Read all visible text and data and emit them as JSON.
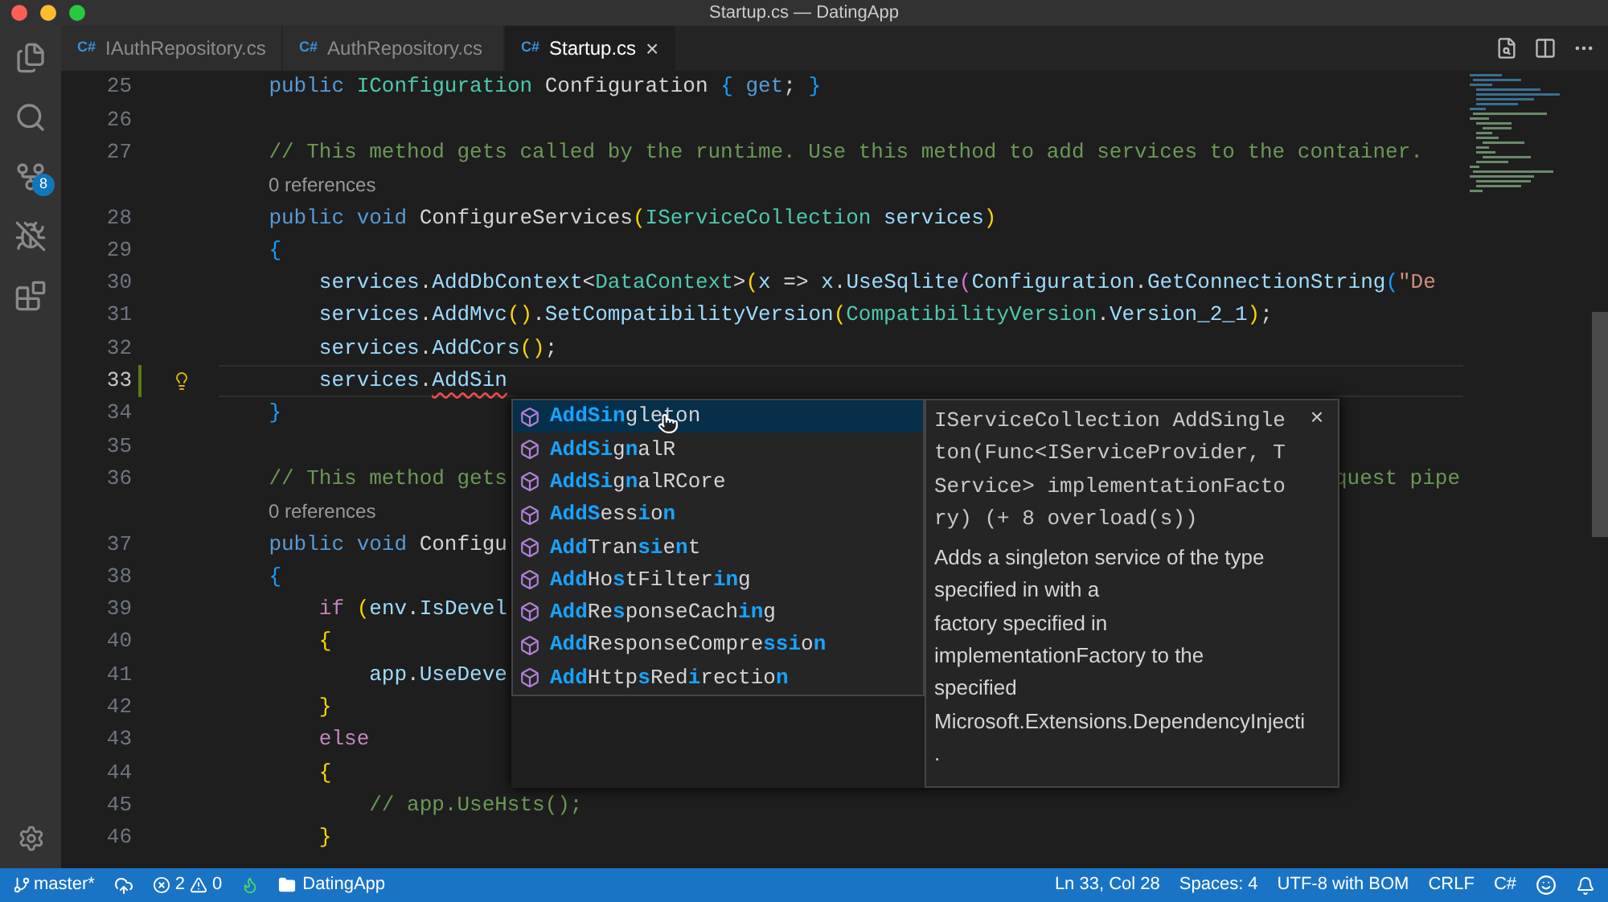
{
  "window": {
    "title": "Startup.cs — DatingApp"
  },
  "activity_bar": {
    "source_control_badge": "8"
  },
  "tabs": [
    {
      "lang": "C#",
      "label": "IAuthRepository.cs",
      "selected": false
    },
    {
      "lang": "C#",
      "label": "AuthRepository.cs",
      "selected": false
    },
    {
      "lang": "C#",
      "label": "Startup.cs",
      "selected": true,
      "close": "×"
    }
  ],
  "editor": {
    "lines": [
      {
        "kind": "code",
        "number": "25",
        "current": false,
        "modified": false,
        "lightbulb": false,
        "tokens": [
          {
            "text": "    public ",
            "kind": "kw"
          },
          {
            "text": "IConfiguration",
            "kind": "type"
          },
          {
            "text": " Configuration ",
            "kind": "p"
          },
          {
            "text": "{ ",
            "kind": "b1"
          },
          {
            "text": "get",
            "kind": "kw"
          },
          {
            "text": "; ",
            "kind": "p"
          },
          {
            "text": "}",
            "kind": "b1"
          }
        ]
      },
      {
        "kind": "code",
        "number": "26",
        "current": false,
        "modified": false,
        "lightbulb": false
      },
      {
        "kind": "code",
        "number": "27",
        "current": false,
        "modified": false,
        "lightbulb": false,
        "tokens": [
          {
            "text": "    // This method gets called by the runtime. Use this method to add services to the container.",
            "kind": "c"
          }
        ]
      },
      {
        "kind": "lens",
        "text": "0 references"
      },
      {
        "kind": "code",
        "number": "28",
        "current": false,
        "modified": false,
        "lightbulb": false,
        "tokens": [
          {
            "text": "    public void ",
            "kind": "kw"
          },
          {
            "text": "ConfigureServices",
            "kind": "p"
          },
          {
            "text": "(",
            "kind": "b2"
          },
          {
            "text": "IServiceCollection",
            "kind": "type"
          },
          {
            "text": " services",
            "kind": "v"
          },
          {
            "text": ")",
            "kind": "b2"
          }
        ]
      },
      {
        "kind": "code",
        "number": "29",
        "current": false,
        "modified": false,
        "lightbulb": false,
        "tokens": [
          {
            "text": "    {",
            "kind": "b1"
          }
        ]
      },
      {
        "kind": "code",
        "number": "30",
        "current": false,
        "modified": false,
        "lightbulb": false,
        "tokens": [
          {
            "text": "        services",
            "kind": "v"
          },
          {
            "text": ".",
            "kind": "p"
          },
          {
            "text": "AddDbContext",
            "kind": "v"
          },
          {
            "text": "<",
            "kind": "p"
          },
          {
            "text": "DataContext",
            "kind": "type"
          },
          {
            "text": ">",
            "kind": "p"
          },
          {
            "text": "(",
            "kind": "b2"
          },
          {
            "text": "x",
            "kind": "v"
          },
          {
            "text": " => ",
            "kind": "p"
          },
          {
            "text": "x",
            "kind": "v"
          },
          {
            "text": ".",
            "kind": "p"
          },
          {
            "text": "UseSqlite",
            "kind": "v"
          },
          {
            "text": "(",
            "kind": "b3"
          },
          {
            "text": "Configuration",
            "kind": "v"
          },
          {
            "text": ".",
            "kind": "p"
          },
          {
            "text": "GetConnectionString",
            "kind": "v"
          },
          {
            "text": "(",
            "kind": "b1"
          },
          {
            "text": "\"De",
            "kind": "s"
          }
        ]
      },
      {
        "kind": "code",
        "number": "31",
        "current": false,
        "modified": false,
        "lightbulb": false,
        "tokens": [
          {
            "text": "        services",
            "kind": "v"
          },
          {
            "text": ".",
            "kind": "p"
          },
          {
            "text": "AddMvc",
            "kind": "v"
          },
          {
            "text": "()",
            "kind": "b2"
          },
          {
            "text": ".",
            "kind": "p"
          },
          {
            "text": "SetCompatibilityVersion",
            "kind": "v"
          },
          {
            "text": "(",
            "kind": "b2"
          },
          {
            "text": "CompatibilityVersion",
            "kind": "type"
          },
          {
            "text": ".",
            "kind": "p"
          },
          {
            "text": "Version_2_1",
            "kind": "v"
          },
          {
            "text": ")",
            "kind": "b2"
          },
          {
            "text": ";",
            "kind": "p"
          }
        ]
      },
      {
        "kind": "code",
        "number": "32",
        "current": false,
        "modified": false,
        "lightbulb": false,
        "tokens": [
          {
            "text": "        services",
            "kind": "v"
          },
          {
            "text": ".",
            "kind": "p"
          },
          {
            "text": "AddCors",
            "kind": "v"
          },
          {
            "text": "()",
            "kind": "b2"
          },
          {
            "text": ";",
            "kind": "p"
          }
        ]
      },
      {
        "kind": "code",
        "number": "33",
        "current": true,
        "modified": true,
        "lightbulb": true,
        "tokens": [
          {
            "text": "        services",
            "kind": "v"
          },
          {
            "text": ".",
            "kind": "p"
          },
          {
            "text": "AddSin",
            "kind": "err"
          }
        ]
      },
      {
        "kind": "code",
        "number": "34",
        "current": false,
        "modified": false,
        "lightbulb": false,
        "tokens": [
          {
            "text": "    }",
            "kind": "b1"
          }
        ]
      },
      {
        "kind": "code",
        "number": "35",
        "current": false,
        "modified": false,
        "lightbulb": false
      },
      {
        "kind": "code",
        "number": "36",
        "current": false,
        "modified": false,
        "lightbulb": false,
        "tokens": [
          {
            "text": "    // This method gets",
            "kind": "c"
          }
        ],
        "tail": "quest pipe"
      },
      {
        "kind": "lens",
        "text": "0 references"
      },
      {
        "kind": "code",
        "number": "37",
        "current": false,
        "modified": false,
        "lightbulb": false,
        "tokens": [
          {
            "text": "    public void ",
            "kind": "kw"
          },
          {
            "text": "Configu",
            "kind": "p"
          }
        ]
      },
      {
        "kind": "code",
        "number": "38",
        "current": false,
        "modified": false,
        "lightbulb": false,
        "tokens": [
          {
            "text": "    {",
            "kind": "b1"
          }
        ]
      },
      {
        "kind": "code",
        "number": "39",
        "current": false,
        "modified": false,
        "lightbulb": false,
        "tokens": [
          {
            "text": "        if ",
            "kind": "ctl"
          },
          {
            "text": "(",
            "kind": "b2"
          },
          {
            "text": "env",
            "kind": "v"
          },
          {
            "text": ".",
            "kind": "p"
          },
          {
            "text": "IsDevel",
            "kind": "v"
          }
        ]
      },
      {
        "kind": "code",
        "number": "40",
        "current": false,
        "modified": false,
        "lightbulb": false,
        "tokens": [
          {
            "text": "        {",
            "kind": "b2"
          }
        ]
      },
      {
        "kind": "code",
        "number": "41",
        "current": false,
        "modified": false,
        "lightbulb": false,
        "tokens": [
          {
            "text": "            app",
            "kind": "v"
          },
          {
            "text": ".",
            "kind": "p"
          },
          {
            "text": "UseDeve",
            "kind": "v"
          }
        ]
      },
      {
        "kind": "code",
        "number": "42",
        "current": false,
        "modified": false,
        "lightbulb": false,
        "tokens": [
          {
            "text": "        }",
            "kind": "b2"
          }
        ]
      },
      {
        "kind": "code",
        "number": "43",
        "current": false,
        "modified": false,
        "lightbulb": false,
        "tokens": [
          {
            "text": "        else",
            "kind": "ctl"
          }
        ]
      },
      {
        "kind": "code",
        "number": "44",
        "current": false,
        "modified": false,
        "lightbulb": false,
        "tokens": [
          {
            "text": "        {",
            "kind": "b2"
          }
        ]
      },
      {
        "kind": "code",
        "number": "45",
        "current": false,
        "modified": false,
        "lightbulb": false,
        "tokens": [
          {
            "text": "            // app.UseHsts();",
            "kind": "c"
          }
        ]
      },
      {
        "kind": "code",
        "number": "46",
        "current": false,
        "modified": false,
        "lightbulb": false,
        "tokens": [
          {
            "text": "        }",
            "kind": "b2"
          }
        ]
      }
    ]
  },
  "suggestions": [
    {
      "selected": true,
      "parts": [
        {
          "text": "AddSin",
          "kind": "match"
        },
        {
          "text": "gleton",
          "kind": "plain"
        }
      ]
    },
    {
      "selected": false,
      "parts": [
        {
          "text": "AddSi",
          "kind": "match"
        },
        {
          "text": "g",
          "kind": "plain"
        },
        {
          "text": "n",
          "kind": "match"
        },
        {
          "text": "alR",
          "kind": "plain"
        }
      ]
    },
    {
      "selected": false,
      "parts": [
        {
          "text": "AddSi",
          "kind": "match"
        },
        {
          "text": "g",
          "kind": "plain"
        },
        {
          "text": "n",
          "kind": "match"
        },
        {
          "text": "alRCore",
          "kind": "plain"
        }
      ]
    },
    {
      "selected": false,
      "parts": [
        {
          "text": "AddS",
          "kind": "match"
        },
        {
          "text": "ess",
          "kind": "plain"
        },
        {
          "text": "i",
          "kind": "match"
        },
        {
          "text": "o",
          "kind": "plain"
        },
        {
          "text": "n",
          "kind": "match"
        }
      ]
    },
    {
      "selected": false,
      "parts": [
        {
          "text": "Add",
          "kind": "match"
        },
        {
          "text": "Tran",
          "kind": "plain"
        },
        {
          "text": "si",
          "kind": "match"
        },
        {
          "text": "e",
          "kind": "plain"
        },
        {
          "text": "n",
          "kind": "match"
        },
        {
          "text": "t",
          "kind": "plain"
        }
      ]
    },
    {
      "selected": false,
      "parts": [
        {
          "text": "Add",
          "kind": "match"
        },
        {
          "text": "Ho",
          "kind": "plain"
        },
        {
          "text": "s",
          "kind": "match"
        },
        {
          "text": "tFilter",
          "kind": "plain"
        },
        {
          "text": "in",
          "kind": "match"
        },
        {
          "text": "g",
          "kind": "plain"
        }
      ]
    },
    {
      "selected": false,
      "parts": [
        {
          "text": "Add",
          "kind": "match"
        },
        {
          "text": "Re",
          "kind": "plain"
        },
        {
          "text": "s",
          "kind": "match"
        },
        {
          "text": "ponseCach",
          "kind": "plain"
        },
        {
          "text": "in",
          "kind": "match"
        },
        {
          "text": "g",
          "kind": "plain"
        }
      ]
    },
    {
      "selected": false,
      "parts": [
        {
          "text": "Add",
          "kind": "match"
        },
        {
          "text": "ResponseCompre",
          "kind": "plain"
        },
        {
          "text": "ssi",
          "kind": "match"
        },
        {
          "text": "o",
          "kind": "plain"
        },
        {
          "text": "n",
          "kind": "match"
        }
      ]
    },
    {
      "selected": false,
      "parts": [
        {
          "text": "Add",
          "kind": "match"
        },
        {
          "text": "Http",
          "kind": "plain"
        },
        {
          "text": "s",
          "kind": "match"
        },
        {
          "text": "Red",
          "kind": "plain"
        },
        {
          "text": "i",
          "kind": "match"
        },
        {
          "text": "rectio",
          "kind": "plain"
        },
        {
          "text": "n",
          "kind": "match"
        }
      ]
    }
  ],
  "details": {
    "close": "×",
    "signature": [
      "IServiceCollection AddSingle",
      "ton(Func<IServiceProvider, T",
      "Service> implementationFacto",
      "ry) (+ 8 overload(s))"
    ],
    "docs": [
      "Adds a singleton service of the type",
      "specified in with a",
      "factory specified in",
      "implementationFactory to the",
      "specified",
      "Microsoft.Extensions.DependencyInjecti",
      "."
    ]
  },
  "status_bar": {
    "branch": "master*",
    "errors": "2",
    "warnings": "0",
    "folder": "DatingApp",
    "position": "Ln 33, Col 28",
    "spaces": "Spaces: 4",
    "encoding": "UTF-8 with BOM",
    "eol": "CRLF",
    "language": "C#"
  }
}
